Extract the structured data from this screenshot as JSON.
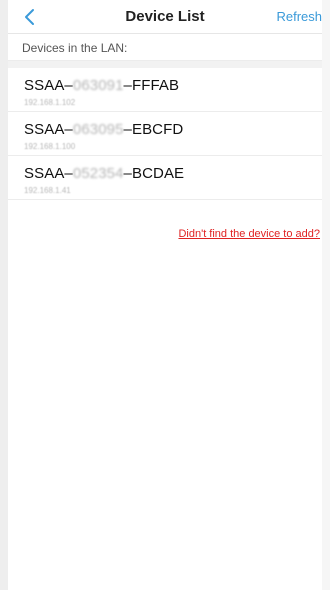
{
  "header": {
    "title": "Device List",
    "refresh_label": "Refresh"
  },
  "section": {
    "label": "Devices in the LAN:"
  },
  "devices": [
    {
      "prefix": "SSAA–",
      "mid": "063091",
      "suffix": "–FFFAB",
      "ip": "192.168.1.102"
    },
    {
      "prefix": "SSAA–",
      "mid": "063095",
      "suffix": "–EBCFD",
      "ip": "192.168.1.100"
    },
    {
      "prefix": "SSAA–",
      "mid": "052354",
      "suffix": "–BCDAE",
      "ip": "192.168.1.41"
    }
  ],
  "footer": {
    "not_found_link": "Didn't find the device to add?"
  },
  "colors": {
    "accent": "#3a9ad9",
    "link_red": "#e02222"
  },
  "icons": {
    "back": "chevron-left-icon"
  }
}
